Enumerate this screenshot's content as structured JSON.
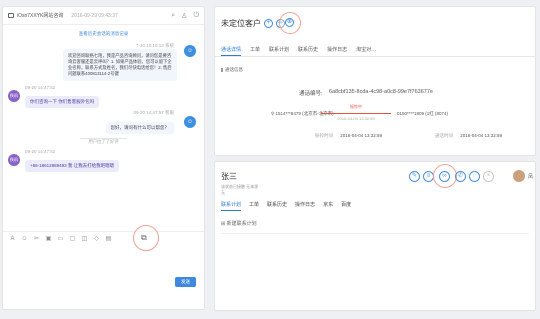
{
  "chat": {
    "window_title": "iOsn7XXYK网站咨询",
    "window_time": "2016-09-29 09:43:37",
    "history_link": "查看历史会话的消息记录",
    "msg1_time": "7-20 10:10:13 系统",
    "msg1_text": "欢迎咨询联络七陌，我是产品咨询顾问，请问您是要咨询云客服还是云呼叫？1. 如果产品体验，您可以留下企业名称，联系方式及姓名，我们尽快电话给您！2. 售后问题联系400813114-2号键",
    "msg2_time": "09-20 14:47:52",
    "msg2_avatar": "佚机",
    "msg2_text": "你们咨询一下 你们售客服外包吗",
    "msg3_time": "09-20 14:47:57 客服",
    "msg3_text": "您好，请问有什么可以帮您？",
    "notice": "用户拉了了好评",
    "msg4_time": "09-20 14:47:52",
    "msg4_avatar": "佚机",
    "msg4_text": "+86-18612889493 我 让我去打给我吧嗯嗯",
    "send_label": "发送"
  },
  "top": {
    "title": "未定位客户",
    "tabs": [
      "通话详情",
      "工单",
      "联系计划",
      "联系历史",
      "操作日志",
      "淘宝对…"
    ],
    "section": "通话信息",
    "call_id_label": "通话编号:",
    "call_id": "6a8cbf135-8cda-4c98-a0c8-99e7f763677e",
    "route_left": "1514***8479 (北京市-北京市)",
    "route_state": "振铃中",
    "route_date": "2016-04-04 13:32:59",
    "route_right": "0150****1809 (1红 (8074)",
    "rec1_label": "振铃时间",
    "rec1_value": "2016-04-04 13:32:59",
    "rec2_label": "通话时间",
    "rec2_value": "2016-04-04 13:32:59"
  },
  "bottom": {
    "name": "张三",
    "sub1": "该状态已接触    无来源",
    "sub2": "无",
    "tabs": [
      "联系计划",
      "工单",
      "联系历史",
      "操作日志",
      "京东",
      "百度"
    ],
    "new_plan": "新建联系计划",
    "user_label": "凤"
  }
}
